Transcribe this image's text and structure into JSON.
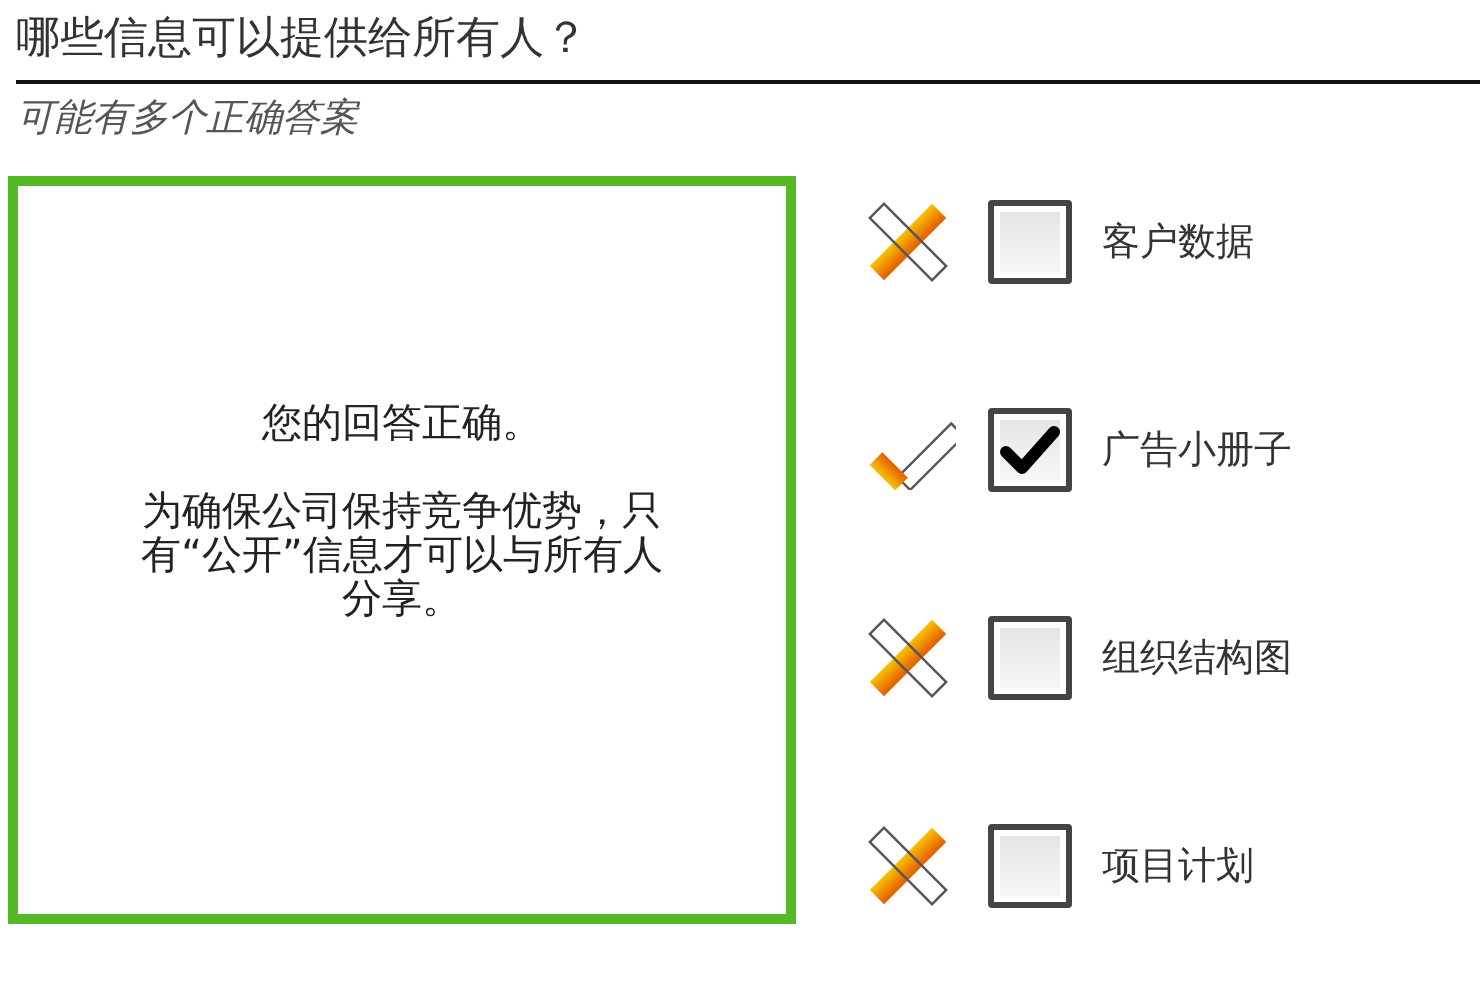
{
  "question": "哪些信息可以提供给所有人？",
  "hint": "可能有多个正确答案",
  "feedback": {
    "correct": true,
    "paragraphs": [
      "您的回答正确。",
      "为确保公司保持竞争优势，只有“公开”信息才可以与所有人分享。"
    ]
  },
  "options": [
    {
      "label": "客户数据",
      "checked": false,
      "correct": false
    },
    {
      "label": "广告小册子",
      "checked": true,
      "correct": true
    },
    {
      "label": "组织结构图",
      "checked": false,
      "correct": false
    },
    {
      "label": "项目计划",
      "checked": false,
      "correct": false
    }
  ]
}
